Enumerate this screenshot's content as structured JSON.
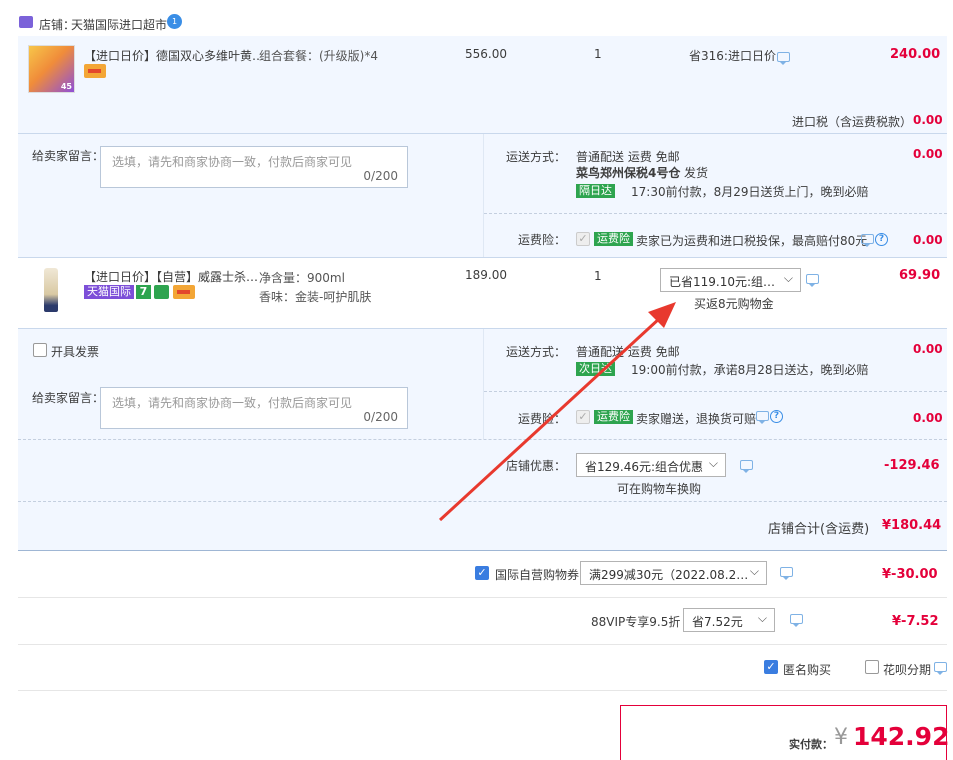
{
  "store": {
    "label": "店铺：",
    "name": "天猫国际进口超市"
  },
  "item1": {
    "title": "【进口日价】德国双心多维叶黄…",
    "spec": "组合套餐：(升级版)*4",
    "price": "556.00",
    "qty": "1",
    "discount": "省316:进口日价",
    "total": "240.00",
    "thumb_badge": "45"
  },
  "import_tax": {
    "label": "进口税（含运费税款）",
    "value": "0.00"
  },
  "block1": {
    "msg_label": "给卖家留言：",
    "msg_placeholder": "选填，请先和商家协商一致，付款后商家可见",
    "msg_count": "0/200",
    "ship_label": "运送方式：",
    "ship_method": "普通配送 运费 免邮",
    "warehouse": "菜鸟郑州保税4号仓",
    "ship_word": "发货",
    "ship_tag": "隔日达",
    "ship_note": "17:30前付款，8月29日送货上门，晚到必赔",
    "ship_value": "0.00",
    "ins_label": "运费险：",
    "ins_tag": "运费险",
    "ins_text": "卖家已为运费和进口税投保，最高赔付80元",
    "ins_value": "0.00"
  },
  "item2": {
    "title": "【进口日价】【自营】威露士杀…",
    "spec1": "净含量：900ml",
    "spec2": "香味：金装-呵护肌肤",
    "price": "189.00",
    "qty": "1",
    "discount_select": "已省119.10元:组…",
    "rebate": "买返8元购物金",
    "total": "69.90",
    "tag_tmall": "天猫国际",
    "tag_7": "7"
  },
  "block2": {
    "invoice_label": "开具发票",
    "msg_label": "给卖家留言：",
    "msg_placeholder": "选填，请先和商家协商一致，付款后商家可见",
    "msg_count": "0/200",
    "ship_label": "运送方式：",
    "ship_method": "普通配送 运费 免邮",
    "ship_tag": "次日达",
    "ship_note": "19:00前付款，承诺8月28日送达，晚到必赔",
    "ship_value": "0.00",
    "ins_label": "运费险：",
    "ins_tag": "运费险",
    "ins_text": "卖家赠送，退换货可赔",
    "ins_value": "0.00"
  },
  "store_discount": {
    "label": "店铺优惠：",
    "select": "省129.46元:组合优惠",
    "note": "可在购物车换购",
    "value": "-129.46"
  },
  "store_total": {
    "label": "店铺合计(含运费)",
    "value": "¥180.44"
  },
  "coupon": {
    "label": "国际自营购物券",
    "select": "满299减30元（2022.08.2…",
    "value": "¥-30.00"
  },
  "vip": {
    "label": "88VIP专享9.5折",
    "select": "省7.52元",
    "value": "¥-7.52"
  },
  "options": {
    "anonymous": "匿名购买",
    "huabei": "花呗分期"
  },
  "pay": {
    "label": "实付款：",
    "currency": "¥",
    "amount": "142.92"
  },
  "colors": {
    "accent_red": "#e4003a",
    "blue_bg": "#f2f7ff",
    "arrow": "#e8392e",
    "tag_green": "#2ea44f",
    "tag_purple": "#7d4fd8"
  }
}
